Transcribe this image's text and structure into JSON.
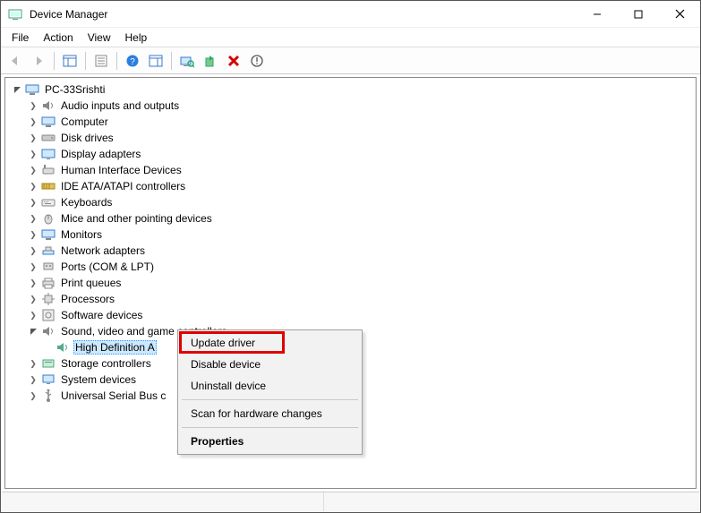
{
  "window": {
    "title": "Device Manager"
  },
  "menu": {
    "file": "File",
    "action": "Action",
    "view": "View",
    "help": "Help"
  },
  "tree": {
    "root": "PC-33Srishti",
    "items": [
      "Audio inputs and outputs",
      "Computer",
      "Disk drives",
      "Display adapters",
      "Human Interface Devices",
      "IDE ATA/ATAPI controllers",
      "Keyboards",
      "Mice and other pointing devices",
      "Monitors",
      "Network adapters",
      "Ports (COM & LPT)",
      "Print queues",
      "Processors",
      "Software devices",
      "Sound, video and game controllers",
      "Storage controllers",
      "System devices",
      "Universal Serial Bus c"
    ],
    "expanded_child": "High Definition A"
  },
  "context": {
    "update": "Update driver",
    "disable": "Disable device",
    "uninstall": "Uninstall device",
    "scan": "Scan for hardware changes",
    "properties": "Properties"
  }
}
